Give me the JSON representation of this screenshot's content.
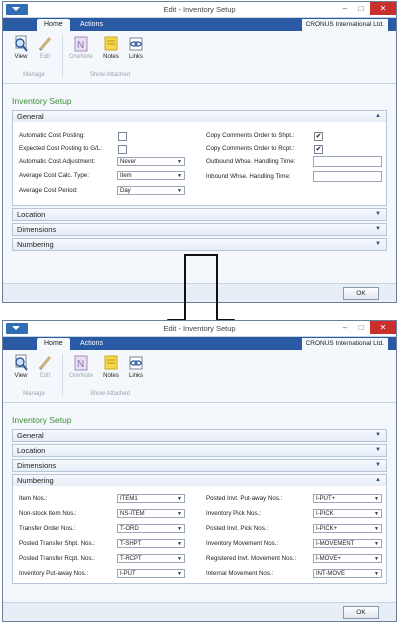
{
  "window": {
    "title": "Edit - Inventory Setup",
    "company": "CRONUS International Ltd."
  },
  "tabs": [
    "Home",
    "Actions"
  ],
  "ribbon": {
    "buttons": [
      "View",
      "Edit",
      "OneNote",
      "Notes",
      "Links"
    ],
    "groups": [
      "Manage",
      "Show Attached"
    ]
  },
  "page_title": "Inventory Setup",
  "fasttabs": {
    "general": "General",
    "location": "Location",
    "dimensions": "Dimensions",
    "numbering": "Numbering"
  },
  "general": {
    "automatic_cost_posting": {
      "label": "Automatic Cost Posting:",
      "checked": false
    },
    "expected_cost_posting": {
      "label": "Expected Cost Posting to G/L:",
      "checked": false
    },
    "automatic_cost_adjustment": {
      "label": "Automatic Cost Adjustment:",
      "value": "Never"
    },
    "average_cost_calc_type": {
      "label": "Average Cost Calc. Type:",
      "value": "Item"
    },
    "average_cost_period": {
      "label": "Average Cost Period:",
      "value": "Day"
    },
    "copy_comments_shpt": {
      "label": "Copy Comments Order to Shpt.:",
      "checked": true,
      "mark": "✔"
    },
    "copy_comments_rcpt": {
      "label": "Copy Comments Order to Rcpt.:",
      "checked": true,
      "mark": "✔"
    },
    "outbound_whse": {
      "label": "Outbound Whse. Handling Time:",
      "value": ""
    },
    "inbound_whse": {
      "label": "Inbound Whse. Handling Time:",
      "value": ""
    }
  },
  "numbering": {
    "left": [
      {
        "label": "Item Nos.:",
        "value": "ITEM1"
      },
      {
        "label": "Non-stock Item Nos.:",
        "value": "NS-ITEM"
      },
      {
        "label": "Transfer Order Nos.:",
        "value": "T-ORD"
      },
      {
        "label": "Posted Transfer Shpt. Nos.:",
        "value": "T-SHPT"
      },
      {
        "label": "Posted Transfer Rcpt. Nos.:",
        "value": "T-RCPT"
      },
      {
        "label": "Inventory Put-away Nos.:",
        "value": "I-PUT"
      }
    ],
    "right": [
      {
        "label": "Posted Invt. Put-away Nos.:",
        "value": "I-PUT+"
      },
      {
        "label": "Inventory Pick Nos.:",
        "value": "I-PICK"
      },
      {
        "label": "Posted Invt. Pick Nos.:",
        "value": "I-PICK+"
      },
      {
        "label": "Inventory Movement Nos.:",
        "value": "I-MOVEMENT"
      },
      {
        "label": "Registered Invt. Movement Nos.:",
        "value": "I-MOVE+"
      },
      {
        "label": "Internal Movement Nos.:",
        "value": "INT-MOVE"
      }
    ]
  },
  "ok_label": "OK",
  "colors": {
    "accent": "#2a5aa3",
    "title_green": "#3f8f3a",
    "close_red": "#c9302c"
  }
}
